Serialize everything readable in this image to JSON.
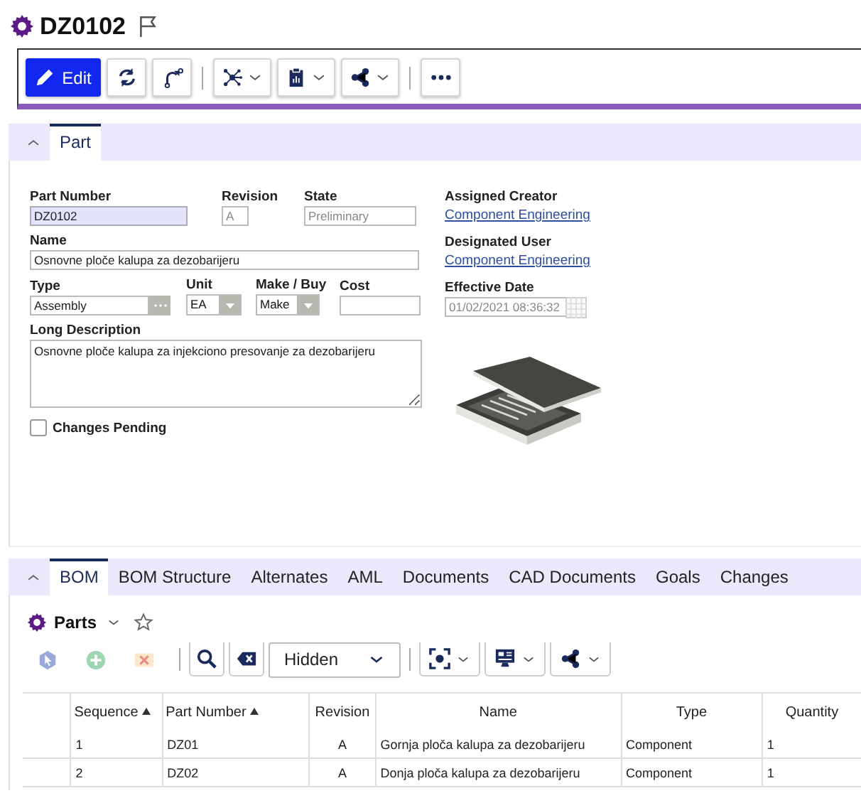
{
  "title": "DZ0102",
  "toolbar": [
    {
      "kind": "primary",
      "label": "Edit"
    },
    {
      "kind": "button"
    },
    {
      "kind": "button"
    },
    {
      "kind": "separator"
    },
    {
      "kind": "menu"
    },
    {
      "kind": "menu"
    },
    {
      "kind": "menu"
    },
    {
      "kind": "separator"
    },
    {
      "kind": "button"
    }
  ],
  "part_tabs": [
    {
      "label": "Part",
      "selected": true
    }
  ],
  "form": {
    "part_number": {
      "label": "Part Number",
      "value": "DZ0102",
      "focused": true
    },
    "revision": {
      "label": "Revision",
      "value": "A"
    },
    "state": {
      "label": "State",
      "value": "Preliminary"
    },
    "name": {
      "label": "Name",
      "value": "Osnovne ploče kalupa za dezobarijeru"
    },
    "type": {
      "label": "Type",
      "value": "Assembly"
    },
    "unit": {
      "label": "Unit",
      "value": "EA"
    },
    "make_buy": {
      "label": "Make / Buy",
      "value": "Make"
    },
    "cost": {
      "label": "Cost"
    },
    "long_description": {
      "label": "Long Description",
      "value": "Osnovne ploče kalupa za injekciono presovanje za dezobarijeru"
    },
    "changes_pending": {
      "label": "Changes Pending",
      "checked": false
    },
    "assigned_creator": {
      "label": "Assigned Creator",
      "value": "Component Engineering"
    },
    "designated_user": {
      "label": "Designated User",
      "value": "Component Engineering"
    },
    "effective_date": {
      "label": "Effective Date",
      "value": "01/02/2021 08:36:32"
    }
  },
  "bom_tabs": [
    {
      "label": "BOM",
      "selected": true
    },
    {
      "label": "BOM Structure",
      "selected": false
    },
    {
      "label": "Alternates",
      "selected": false
    },
    {
      "label": "AML",
      "selected": false
    },
    {
      "label": "Documents",
      "selected": false
    },
    {
      "label": "CAD Documents",
      "selected": false
    },
    {
      "label": "Goals",
      "selected": false
    },
    {
      "label": "Changes",
      "selected": false
    }
  ],
  "parts_title": "Parts",
  "parts_toolbar": [
    {
      "kind": "plain"
    },
    {
      "kind": "plain"
    },
    {
      "kind": "plain"
    },
    {
      "kind": "separator"
    },
    {
      "kind": "framed"
    },
    {
      "kind": "framed"
    },
    {
      "kind": "select",
      "value": "Hidden"
    },
    {
      "kind": "separator"
    },
    {
      "kind": "menu"
    },
    {
      "kind": "menu"
    },
    {
      "kind": "menu"
    }
  ],
  "table": {
    "columns": [
      {
        "label": "Sequence",
        "sorted": true
      },
      {
        "label": "Part Number",
        "sorted": true
      },
      {
        "label": "Revision",
        "sorted": false
      },
      {
        "label": "Name",
        "sorted": false
      },
      {
        "label": "Type",
        "sorted": false
      },
      {
        "label": "Quantity",
        "sorted": false
      }
    ],
    "rows": [
      [
        "1",
        "DZ01",
        "A",
        "Gornja ploča kalupa za dezobarijeru",
        "Component",
        "1"
      ],
      [
        "2",
        "DZ02",
        "A",
        "Donja ploča kalupa za dezobarijeru",
        "Component",
        "1"
      ]
    ]
  }
}
